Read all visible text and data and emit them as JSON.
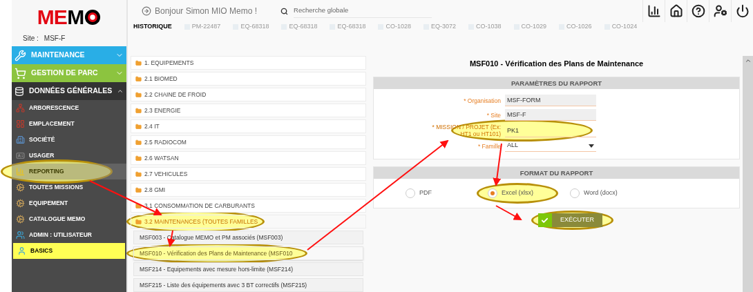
{
  "logo": {
    "text_left": "ME",
    "text_right": "M"
  },
  "site": {
    "label": "Site :",
    "value": "MSF-F"
  },
  "header": {
    "greeting": "Bonjour Simon MIO Memo !",
    "search": {
      "placeholder": "Recherche globale"
    }
  },
  "history": {
    "label": "HISTORIQUE",
    "items": [
      "PM-22487",
      "EQ-68318",
      "EQ-68318",
      "EQ-68318",
      "CO-1028",
      "EQ-3072",
      "CO-1038",
      "CO-1029",
      "CO-1026",
      "CO-1024"
    ]
  },
  "sidebar": {
    "sections": [
      {
        "label": "MAINTENANCE",
        "color": "#29aee6",
        "expanded": false
      },
      {
        "label": "GESTION DE PARC",
        "color": "#8cc43f",
        "expanded": false
      },
      {
        "label": "DONNÉES GÉNÉRALES",
        "color": "#333333",
        "expanded": true,
        "children": [
          {
            "label": "ARBORESCENCE",
            "selected": false,
            "highlighted": false,
            "annotated": false
          },
          {
            "label": "EMPLACEMENT",
            "selected": false,
            "highlighted": false,
            "annotated": false
          },
          {
            "label": "SOCIÉTÉ",
            "selected": false,
            "highlighted": false,
            "annotated": false
          },
          {
            "label": "USAGER",
            "selected": false,
            "highlighted": false,
            "annotated": false
          },
          {
            "label": "REPORTING",
            "selected": true,
            "highlighted": false,
            "annotated": true
          },
          {
            "label": "TOUTES MISSIONS",
            "selected": false,
            "highlighted": false,
            "annotated": false
          },
          {
            "label": "EQUIPEMENT",
            "selected": false,
            "highlighted": false,
            "annotated": false
          },
          {
            "label": "CATALOGUE MEMO",
            "selected": false,
            "highlighted": false,
            "annotated": false
          },
          {
            "label": "ADMIN : UTILISATEUR",
            "selected": false,
            "highlighted": false,
            "annotated": false
          },
          {
            "label": "BASICS",
            "selected": false,
            "highlighted": true,
            "annotated": false
          }
        ]
      }
    ]
  },
  "folders": [
    {
      "label": "1. EQUIPEMENTS",
      "selected": false,
      "annotated": false
    },
    {
      "label": "2.1 BIOMED",
      "selected": false,
      "annotated": false
    },
    {
      "label": "2.2 CHAINE DE FROID",
      "selected": false,
      "annotated": false
    },
    {
      "label": "2.3 ENERGIE",
      "selected": false,
      "annotated": false
    },
    {
      "label": "2.4 IT",
      "selected": false,
      "annotated": false
    },
    {
      "label": "2.5 RADIOCOM",
      "selected": false,
      "annotated": false
    },
    {
      "label": "2.6 WATSAN",
      "selected": false,
      "annotated": false
    },
    {
      "label": "2.7 VEHICULES",
      "selected": false,
      "annotated": false
    },
    {
      "label": "2.8 GMI",
      "selected": false,
      "annotated": false
    },
    {
      "label": "3.1 CONSOMMATION DE CARBURANTS",
      "selected": false,
      "annotated": false
    },
    {
      "label": "3.2 MAINTENANCES (TOUTES FAMILLES",
      "selected": true,
      "annotated": true
    }
  ],
  "reports": [
    {
      "label": "MSF003 - Catalogue MEMO et PM associés (MSF003)",
      "selected": false,
      "annotated": false
    },
    {
      "label": "MSF010 - Vérification des Plans de Maintenance (MSF010",
      "selected": true,
      "annotated": true
    },
    {
      "label": "MSF214 - Equipements avec mesure hors-limite (MSF214)",
      "selected": false,
      "annotated": false
    },
    {
      "label": "MSF215 - Liste des équipements avec 3 BT correctifs (MSF215)",
      "selected": false,
      "annotated": false
    }
  ],
  "report": {
    "title": "MSF010 - Vérification des Plans de Maintenance",
    "parameters": {
      "title": "PARAMÈTRES DU RAPPORT",
      "fields": [
        {
          "label": "* Organisation",
          "value": "MSF-FORM",
          "kind": "readonly"
        },
        {
          "label": "* Site",
          "value": "MSF-F",
          "kind": "readonly"
        },
        {
          "label": "* MISSION / PROJET (Ex: HT1 ou HT101)",
          "value": "PK1",
          "kind": "text",
          "annotated": true
        },
        {
          "label": "* Famille",
          "value": "ALL",
          "kind": "select"
        }
      ]
    },
    "format": {
      "title": "FORMAT DU RAPPORT",
      "options": [
        {
          "label": "PDF",
          "selected": false,
          "annotated": false
        },
        {
          "label": "Excel (xlsx)",
          "selected": true,
          "annotated": true
        },
        {
          "label": "Word (docx)",
          "selected": false,
          "annotated": false
        }
      ]
    },
    "run_button": {
      "label": "EXÉCUTER",
      "annotated": true
    }
  }
}
